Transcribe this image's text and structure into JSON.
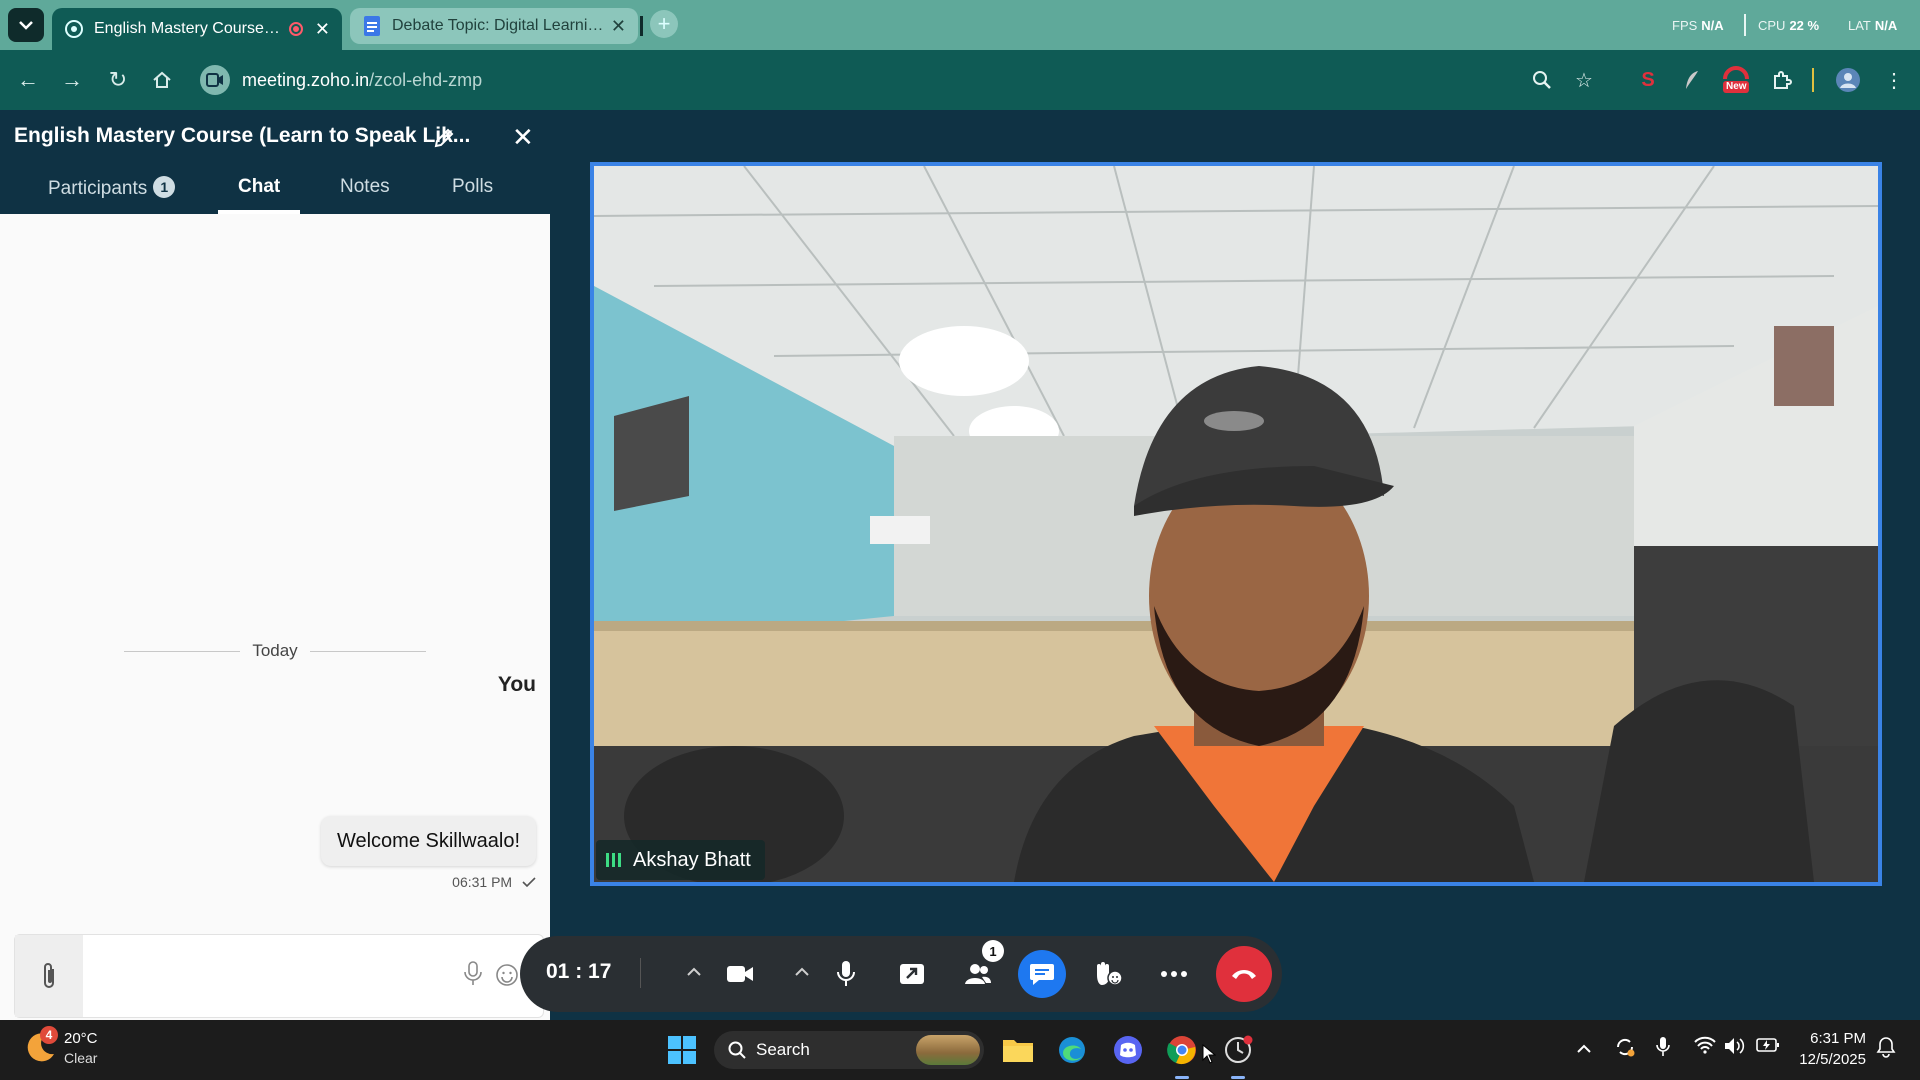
{
  "browser": {
    "tabs": [
      {
        "title": "English Mastery Course (Learn to Speak Like a Native)",
        "active": true,
        "recording": true
      },
      {
        "title": "Debate Topic: Digital Learning vs Traditional Learning",
        "active": false
      }
    ],
    "url_host": "meeting.zoho.in",
    "url_path": "/zcol-ehd-zmp",
    "perf": {
      "fps_label": "FPS",
      "fps_value": "N/A",
      "cpu_label": "CPU",
      "cpu_value": "22 %",
      "lat_label": "LAT",
      "lat_value": "N/A"
    },
    "new_badge": "New"
  },
  "panel": {
    "title": "English Mastery Course (Learn to Speak Lik...",
    "tabs": [
      {
        "label": "Participants",
        "badge": "1"
      },
      {
        "label": "Chat"
      },
      {
        "label": "Notes"
      },
      {
        "label": "Polls"
      }
    ],
    "active_tab": "Chat",
    "chat": {
      "day_divider": "Today",
      "messages": [
        {
          "sender": "You",
          "text": "Welcome Skillwaalo!",
          "time": "06:31 PM"
        }
      ]
    }
  },
  "video": {
    "participant_name": "Akshay Bhatt"
  },
  "callbar": {
    "timer": "01 : 17",
    "participants_badge": "1"
  },
  "taskbar": {
    "weather": {
      "temp": "20°C",
      "desc": "Clear",
      "alert_count": "4"
    },
    "search_label": "Search",
    "clock": {
      "time": "6:31 PM",
      "date": "12/5/2025"
    }
  },
  "colors": {
    "tabstrip": "#5fa99a",
    "toolbar": "#0f5b55",
    "meeting_bg": "#0f3244",
    "video_border": "#3a83e6",
    "chat_button": "#1e78f0",
    "end_call": "#e0303c"
  }
}
